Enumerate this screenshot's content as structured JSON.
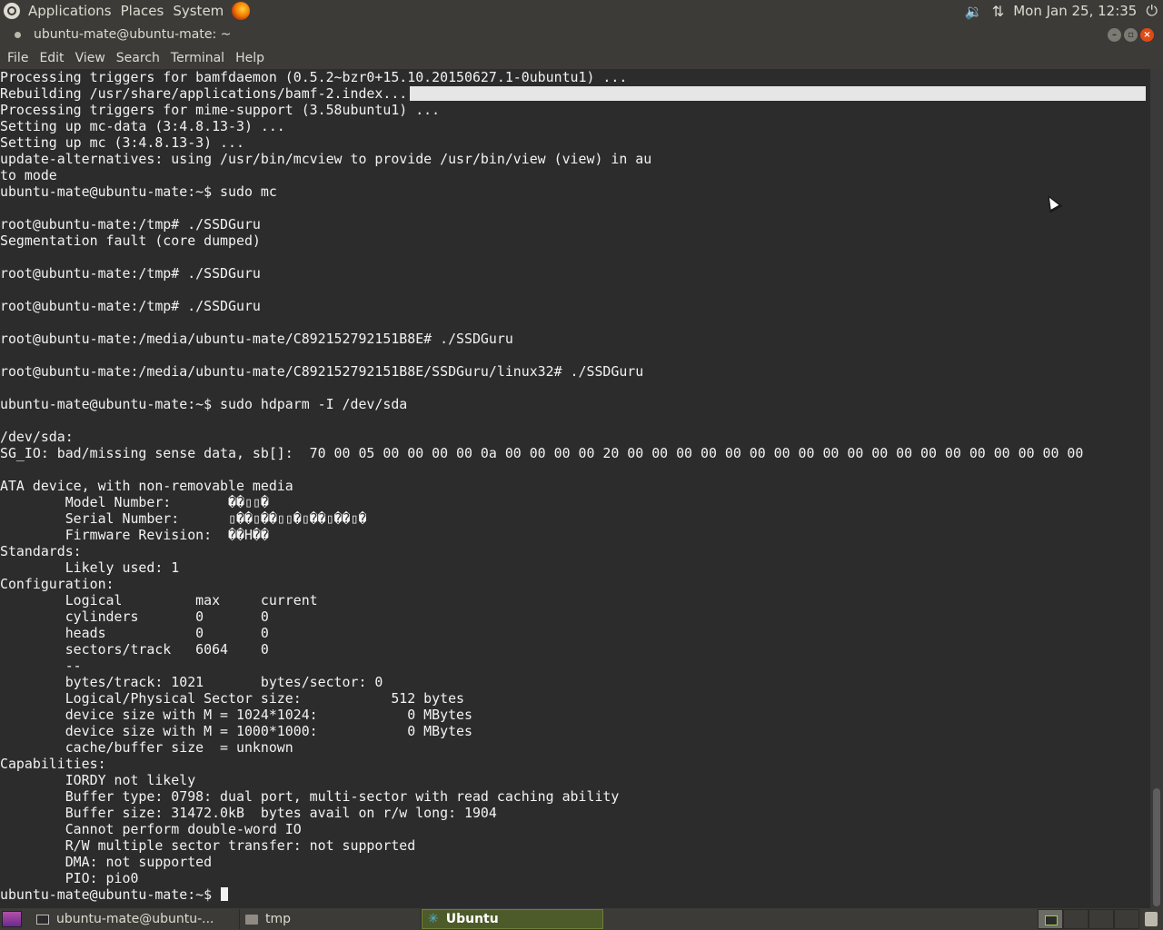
{
  "top_panel": {
    "menus": [
      "Applications",
      "Places",
      "System"
    ],
    "clock": "Mon Jan 25, 12:35",
    "icons": [
      "ubuntu-logo-icon",
      "firefox-icon",
      "volume-icon",
      "network-icon",
      "power-icon"
    ]
  },
  "window": {
    "title": "ubuntu-mate@ubuntu-mate: ~",
    "buttons": [
      "minimize",
      "maximize",
      "close"
    ]
  },
  "menubar": {
    "items": [
      "File",
      "Edit",
      "View",
      "Search",
      "Terminal",
      "Help"
    ]
  },
  "terminal": {
    "lines": [
      "Processing triggers for bamfdaemon (0.5.2~bzr0+15.10.20150627.1-0ubuntu1) ...",
      "Rebuilding /usr/share/applications/bamf-2.index...",
      "Processing triggers for mime-support (3.58ubuntu1) ...",
      "Setting up mc-data (3:4.8.13-3) ...",
      "Setting up mc (3:4.8.13-3) ...",
      "update-alternatives: using /usr/bin/mcview to provide /usr/bin/view (view) in au",
      "to mode",
      "ubuntu-mate@ubuntu-mate:~$ sudo mc",
      "",
      "root@ubuntu-mate:/tmp# ./SSDGuru",
      "Segmentation fault (core dumped)",
      "",
      "root@ubuntu-mate:/tmp# ./SSDGuru",
      "",
      "root@ubuntu-mate:/tmp# ./SSDGuru",
      "",
      "root@ubuntu-mate:/media/ubuntu-mate/C892152792151B8E# ./SSDGuru",
      "",
      "root@ubuntu-mate:/media/ubuntu-mate/C892152792151B8E/SSDGuru/linux32# ./SSDGuru",
      "",
      "ubuntu-mate@ubuntu-mate:~$ sudo hdparm -I /dev/sda",
      "",
      "/dev/sda:",
      "SG_IO: bad/missing sense data, sb[]:  70 00 05 00 00 00 00 0a 00 00 00 00 20 00 00 00 00 00 00 00 00 00 00 00 00 00 00 00 00 00 00 00",
      "",
      "ATA device, with non-removable media",
      "        Model Number:       ��▯▯�",
      "        Serial Number:      ▯��▯��▯▯�▯��▯��▯�",
      "        Firmware Revision:  ��H��",
      "Standards:",
      "        Likely used: 1",
      "Configuration:",
      "        Logical         max     current",
      "        cylinders       0       0",
      "        heads           0       0",
      "        sectors/track   6064    0",
      "        --",
      "        bytes/track: 1021       bytes/sector: 0",
      "        Logical/Physical Sector size:           512 bytes",
      "        device size with M = 1024*1024:           0 MBytes",
      "        device size with M = 1000*1000:           0 MBytes",
      "        cache/buffer size  = unknown",
      "Capabilities:",
      "        IORDY not likely",
      "        Buffer type: 0798: dual port, multi-sector with read caching ability",
      "        Buffer size: 31472.0kB  bytes avail on r/w long: 1904",
      "        Cannot perform double-word IO",
      "        R/W multiple sector transfer: not supported",
      "        DMA: not supported",
      "        PIO: pio0"
    ],
    "prompt": "ubuntu-mate@ubuntu-mate:~$ "
  },
  "taskbar": {
    "tasks": [
      {
        "label": "ubuntu-mate@ubuntu-...",
        "icon": "terminal-icon",
        "active": false
      },
      {
        "label": "tmp",
        "icon": "folder-icon",
        "active": false
      },
      {
        "label": "Ubuntu",
        "icon": "star-icon",
        "active": true
      }
    ],
    "icons": [
      "show-desktop-icon",
      "workspace-switcher",
      "trash-icon"
    ]
  }
}
